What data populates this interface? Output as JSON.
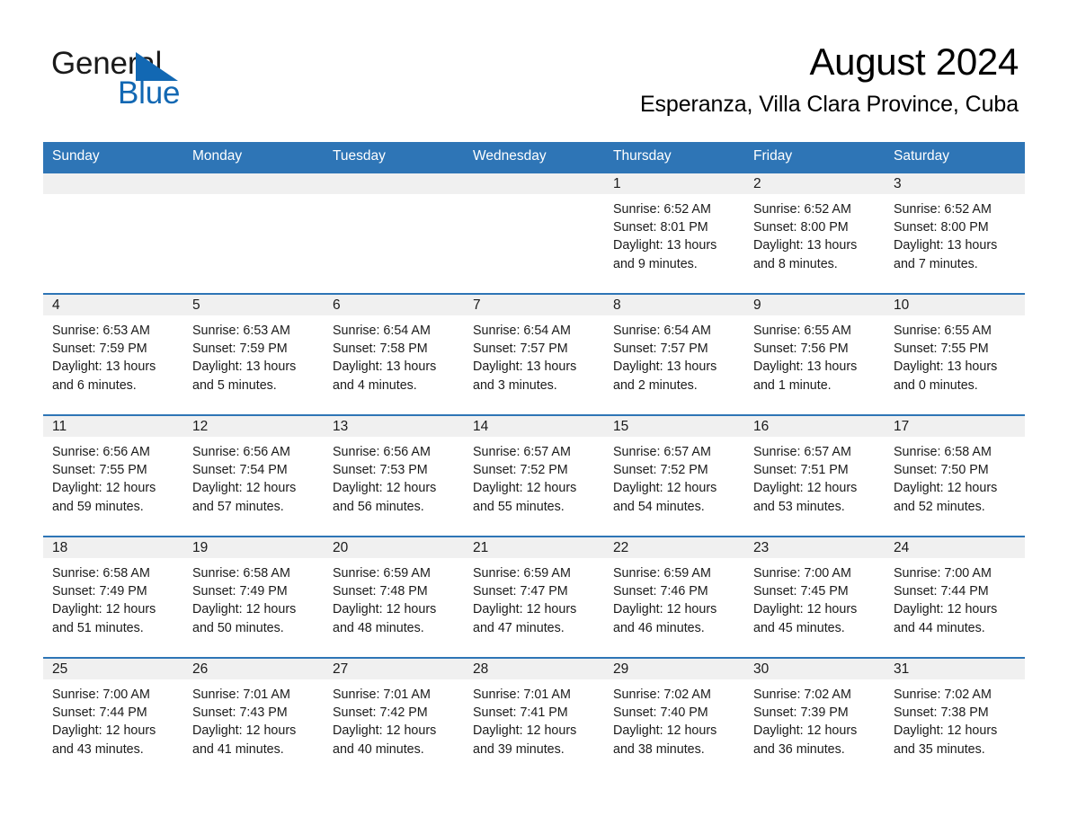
{
  "logo": {
    "text_primary": "General",
    "text_secondary": "Blue",
    "triangle_color": "#1268b3"
  },
  "header": {
    "title": "August 2024",
    "subtitle": "Esperanza, Villa Clara Province, Cuba"
  },
  "colors": {
    "header_blue": "#2e75b6",
    "row_divider_blue": "#2e75b6",
    "daynum_band": "#f0f0f0",
    "text": "#1a1a1a"
  },
  "weekdays": [
    "Sunday",
    "Monday",
    "Tuesday",
    "Wednesday",
    "Thursday",
    "Friday",
    "Saturday"
  ],
  "weeks": [
    [
      {
        "day": "",
        "empty": true
      },
      {
        "day": "",
        "empty": true
      },
      {
        "day": "",
        "empty": true
      },
      {
        "day": "",
        "empty": true
      },
      {
        "day": "1",
        "sunrise": "Sunrise: 6:52 AM",
        "sunset": "Sunset: 8:01 PM",
        "daylight_1": "Daylight: 13 hours",
        "daylight_2": "and 9 minutes."
      },
      {
        "day": "2",
        "sunrise": "Sunrise: 6:52 AM",
        "sunset": "Sunset: 8:00 PM",
        "daylight_1": "Daylight: 13 hours",
        "daylight_2": "and 8 minutes."
      },
      {
        "day": "3",
        "sunrise": "Sunrise: 6:52 AM",
        "sunset": "Sunset: 8:00 PM",
        "daylight_1": "Daylight: 13 hours",
        "daylight_2": "and 7 minutes."
      }
    ],
    [
      {
        "day": "4",
        "sunrise": "Sunrise: 6:53 AM",
        "sunset": "Sunset: 7:59 PM",
        "daylight_1": "Daylight: 13 hours",
        "daylight_2": "and 6 minutes."
      },
      {
        "day": "5",
        "sunrise": "Sunrise: 6:53 AM",
        "sunset": "Sunset: 7:59 PM",
        "daylight_1": "Daylight: 13 hours",
        "daylight_2": "and 5 minutes."
      },
      {
        "day": "6",
        "sunrise": "Sunrise: 6:54 AM",
        "sunset": "Sunset: 7:58 PM",
        "daylight_1": "Daylight: 13 hours",
        "daylight_2": "and 4 minutes."
      },
      {
        "day": "7",
        "sunrise": "Sunrise: 6:54 AM",
        "sunset": "Sunset: 7:57 PM",
        "daylight_1": "Daylight: 13 hours",
        "daylight_2": "and 3 minutes."
      },
      {
        "day": "8",
        "sunrise": "Sunrise: 6:54 AM",
        "sunset": "Sunset: 7:57 PM",
        "daylight_1": "Daylight: 13 hours",
        "daylight_2": "and 2 minutes."
      },
      {
        "day": "9",
        "sunrise": "Sunrise: 6:55 AM",
        "sunset": "Sunset: 7:56 PM",
        "daylight_1": "Daylight: 13 hours",
        "daylight_2": "and 1 minute."
      },
      {
        "day": "10",
        "sunrise": "Sunrise: 6:55 AM",
        "sunset": "Sunset: 7:55 PM",
        "daylight_1": "Daylight: 13 hours",
        "daylight_2": "and 0 minutes."
      }
    ],
    [
      {
        "day": "11",
        "sunrise": "Sunrise: 6:56 AM",
        "sunset": "Sunset: 7:55 PM",
        "daylight_1": "Daylight: 12 hours",
        "daylight_2": "and 59 minutes."
      },
      {
        "day": "12",
        "sunrise": "Sunrise: 6:56 AM",
        "sunset": "Sunset: 7:54 PM",
        "daylight_1": "Daylight: 12 hours",
        "daylight_2": "and 57 minutes."
      },
      {
        "day": "13",
        "sunrise": "Sunrise: 6:56 AM",
        "sunset": "Sunset: 7:53 PM",
        "daylight_1": "Daylight: 12 hours",
        "daylight_2": "and 56 minutes."
      },
      {
        "day": "14",
        "sunrise": "Sunrise: 6:57 AM",
        "sunset": "Sunset: 7:52 PM",
        "daylight_1": "Daylight: 12 hours",
        "daylight_2": "and 55 minutes."
      },
      {
        "day": "15",
        "sunrise": "Sunrise: 6:57 AM",
        "sunset": "Sunset: 7:52 PM",
        "daylight_1": "Daylight: 12 hours",
        "daylight_2": "and 54 minutes."
      },
      {
        "day": "16",
        "sunrise": "Sunrise: 6:57 AM",
        "sunset": "Sunset: 7:51 PM",
        "daylight_1": "Daylight: 12 hours",
        "daylight_2": "and 53 minutes."
      },
      {
        "day": "17",
        "sunrise": "Sunrise: 6:58 AM",
        "sunset": "Sunset: 7:50 PM",
        "daylight_1": "Daylight: 12 hours",
        "daylight_2": "and 52 minutes."
      }
    ],
    [
      {
        "day": "18",
        "sunrise": "Sunrise: 6:58 AM",
        "sunset": "Sunset: 7:49 PM",
        "daylight_1": "Daylight: 12 hours",
        "daylight_2": "and 51 minutes."
      },
      {
        "day": "19",
        "sunrise": "Sunrise: 6:58 AM",
        "sunset": "Sunset: 7:49 PM",
        "daylight_1": "Daylight: 12 hours",
        "daylight_2": "and 50 minutes."
      },
      {
        "day": "20",
        "sunrise": "Sunrise: 6:59 AM",
        "sunset": "Sunset: 7:48 PM",
        "daylight_1": "Daylight: 12 hours",
        "daylight_2": "and 48 minutes."
      },
      {
        "day": "21",
        "sunrise": "Sunrise: 6:59 AM",
        "sunset": "Sunset: 7:47 PM",
        "daylight_1": "Daylight: 12 hours",
        "daylight_2": "and 47 minutes."
      },
      {
        "day": "22",
        "sunrise": "Sunrise: 6:59 AM",
        "sunset": "Sunset: 7:46 PM",
        "daylight_1": "Daylight: 12 hours",
        "daylight_2": "and 46 minutes."
      },
      {
        "day": "23",
        "sunrise": "Sunrise: 7:00 AM",
        "sunset": "Sunset: 7:45 PM",
        "daylight_1": "Daylight: 12 hours",
        "daylight_2": "and 45 minutes."
      },
      {
        "day": "24",
        "sunrise": "Sunrise: 7:00 AM",
        "sunset": "Sunset: 7:44 PM",
        "daylight_1": "Daylight: 12 hours",
        "daylight_2": "and 44 minutes."
      }
    ],
    [
      {
        "day": "25",
        "sunrise": "Sunrise: 7:00 AM",
        "sunset": "Sunset: 7:44 PM",
        "daylight_1": "Daylight: 12 hours",
        "daylight_2": "and 43 minutes."
      },
      {
        "day": "26",
        "sunrise": "Sunrise: 7:01 AM",
        "sunset": "Sunset: 7:43 PM",
        "daylight_1": "Daylight: 12 hours",
        "daylight_2": "and 41 minutes."
      },
      {
        "day": "27",
        "sunrise": "Sunrise: 7:01 AM",
        "sunset": "Sunset: 7:42 PM",
        "daylight_1": "Daylight: 12 hours",
        "daylight_2": "and 40 minutes."
      },
      {
        "day": "28",
        "sunrise": "Sunrise: 7:01 AM",
        "sunset": "Sunset: 7:41 PM",
        "daylight_1": "Daylight: 12 hours",
        "daylight_2": "and 39 minutes."
      },
      {
        "day": "29",
        "sunrise": "Sunrise: 7:02 AM",
        "sunset": "Sunset: 7:40 PM",
        "daylight_1": "Daylight: 12 hours",
        "daylight_2": "and 38 minutes."
      },
      {
        "day": "30",
        "sunrise": "Sunrise: 7:02 AM",
        "sunset": "Sunset: 7:39 PM",
        "daylight_1": "Daylight: 12 hours",
        "daylight_2": "and 36 minutes."
      },
      {
        "day": "31",
        "sunrise": "Sunrise: 7:02 AM",
        "sunset": "Sunset: 7:38 PM",
        "daylight_1": "Daylight: 12 hours",
        "daylight_2": "and 35 minutes."
      }
    ]
  ]
}
